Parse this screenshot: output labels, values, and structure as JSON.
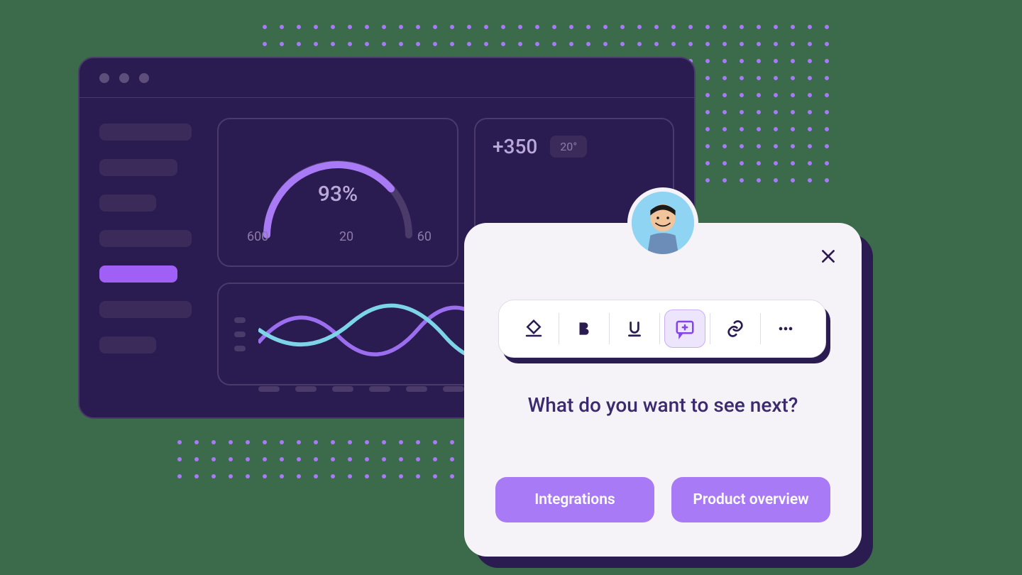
{
  "dashboard": {
    "gauge": {
      "value": "93%",
      "min": "600",
      "mid": "20",
      "max": "60"
    },
    "stat": {
      "value": "+350",
      "badge": "20°"
    }
  },
  "popup": {
    "prompt": "What do you want to see next?",
    "button1": "Integrations",
    "button2": "Product overview"
  },
  "colors": {
    "accent": "#a87af5",
    "dark": "#2a1b50"
  }
}
